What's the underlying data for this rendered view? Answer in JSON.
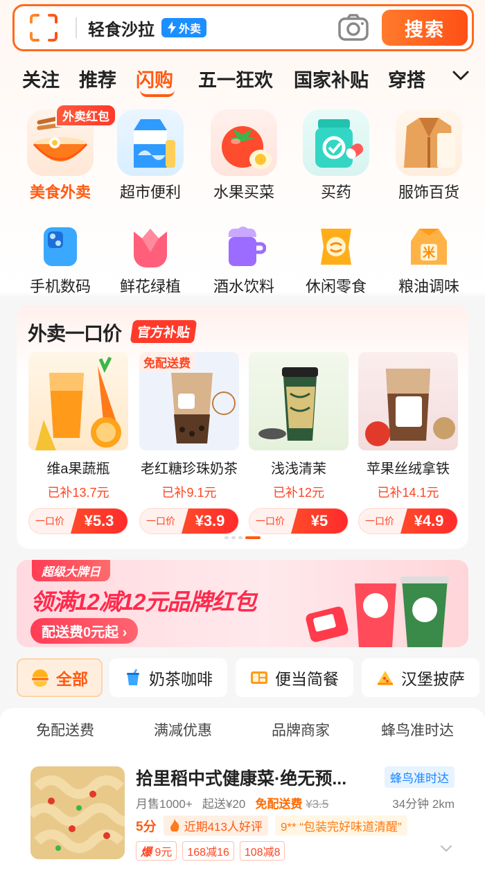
{
  "search": {
    "query": "轻食沙拉",
    "tag": "外卖",
    "button": "搜索"
  },
  "tabs": [
    "关注",
    "推荐",
    "闪购",
    "五一狂欢",
    "国家补贴",
    "穿搭"
  ],
  "active_tab": "闪购",
  "categories_row1": [
    {
      "label": "美食外卖",
      "icon": "noodle-bowl-icon",
      "selected": true,
      "badge": "外卖红包"
    },
    {
      "label": "超市便利",
      "icon": "milk-carton-icon"
    },
    {
      "label": "水果买菜",
      "icon": "tomato-icon"
    },
    {
      "label": "买药",
      "icon": "medicine-bottle-icon"
    },
    {
      "label": "服饰百货",
      "icon": "coat-icon"
    }
  ],
  "categories_row2": [
    {
      "label": "手机数码",
      "icon": "phone-icon",
      "color": "#3aa8ff"
    },
    {
      "label": "鲜花绿植",
      "icon": "tulip-icon",
      "color": "#ff5f7a"
    },
    {
      "label": "酒水饮料",
      "icon": "mug-icon",
      "color": "#9b6cff"
    },
    {
      "label": "休闲零食",
      "icon": "snack-bag-icon",
      "color": "#ffae1a"
    },
    {
      "label": "粮油调味",
      "icon": "rice-bag-icon",
      "color": "#ffb347"
    }
  ],
  "deal": {
    "title": "外卖一口价",
    "badge": "官方补贴",
    "products": [
      {
        "name": "维a果蔬瓶",
        "subsidy": "已补13.7元",
        "price_label": "一口价",
        "price": "¥5.3",
        "tag": ""
      },
      {
        "name": "老红糖珍珠奶茶",
        "subsidy": "已补9.1元",
        "price_label": "一口价",
        "price": "¥3.9",
        "tag": "免配送费"
      },
      {
        "name": "浅浅清茉",
        "subsidy": "已补12元",
        "price_label": "一口价",
        "price": "¥5",
        "tag": ""
      },
      {
        "name": "苹果丝绒拿铁",
        "subsidy": "已补14.1元",
        "price_label": "一口价",
        "price": "¥4.9",
        "tag": ""
      }
    ]
  },
  "banner": {
    "ribbon": "超级大牌日",
    "main": "领满12减12元品牌红包",
    "sub": "配送费0元起 ›"
  },
  "filters": [
    {
      "label": "全部",
      "icon": "all-icon",
      "active": true
    },
    {
      "label": "奶茶咖啡",
      "icon": "drink-icon"
    },
    {
      "label": "便当简餐",
      "icon": "bento-icon"
    },
    {
      "label": "汉堡披萨",
      "icon": "pizza-icon"
    }
  ],
  "subfilters": [
    "免配送费",
    "满减优惠",
    "品牌商家",
    "蜂鸟准时达"
  ],
  "shop": {
    "name": "拾里稻中式健康菜·绝无预...",
    "tag": "蜂鸟准时达",
    "monthly": "月售1000+",
    "min_order": "起送¥20",
    "free_delivery": "免配送费",
    "old_fee": "¥3.5",
    "eta": "34分钟 2km",
    "score": "5分",
    "good_reviews": "近期413人好评",
    "review_quote": "9** “包装完好味道清醒”",
    "promos": [
      {
        "highlight": "爆",
        "text": "9元"
      },
      {
        "highlight": "",
        "text": "168减16"
      },
      {
        "highlight": "",
        "text": "108减8"
      }
    ]
  },
  "colors": {
    "accent": "#ff5a12",
    "red": "#ff3a2a",
    "blue": "#1b8fff"
  }
}
